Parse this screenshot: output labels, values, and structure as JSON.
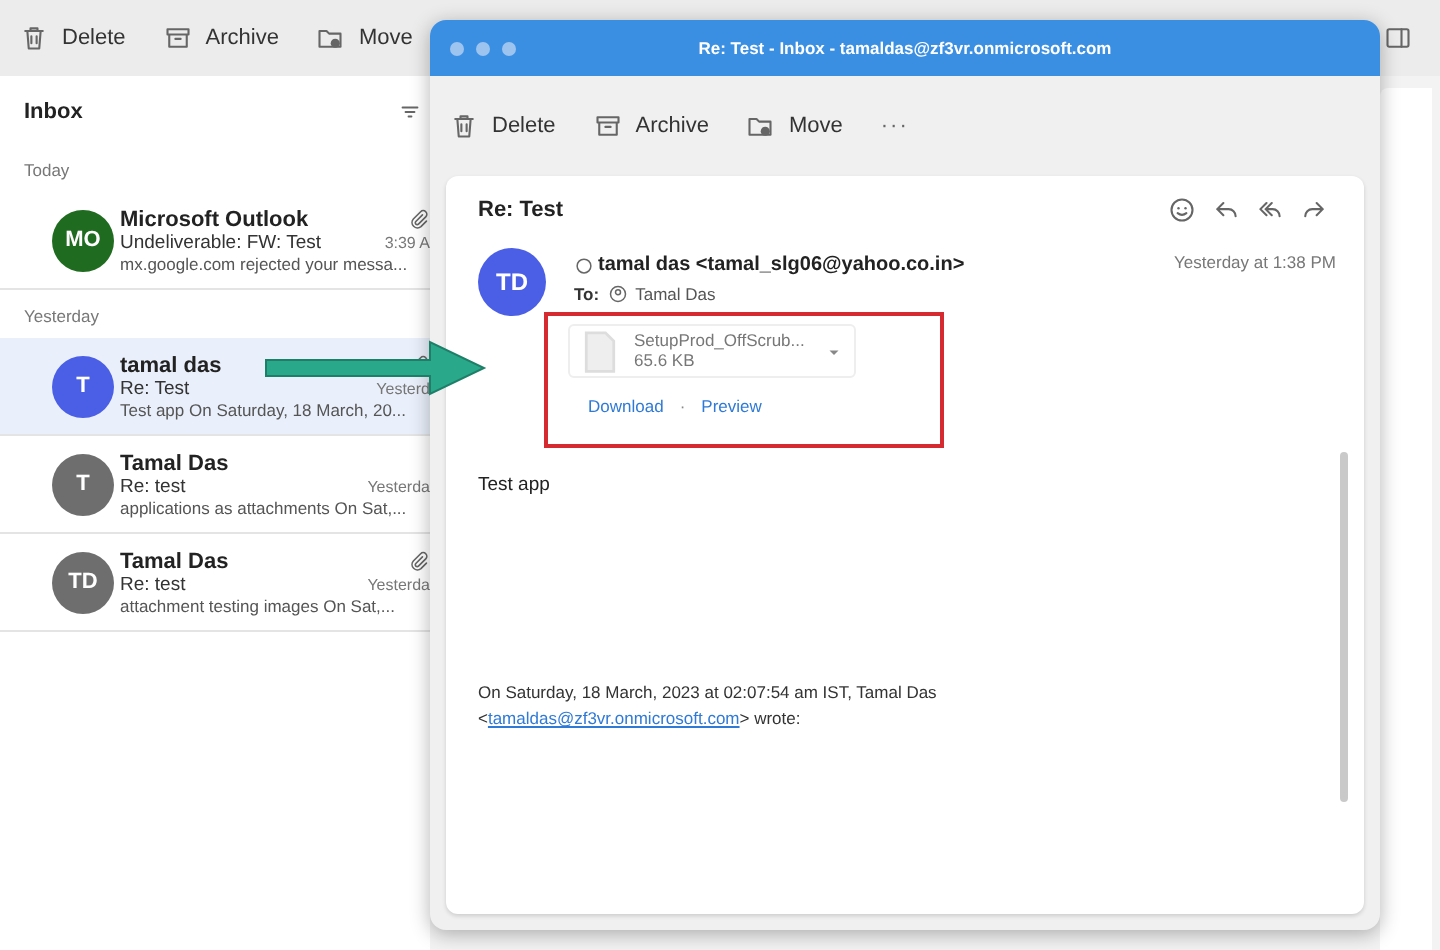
{
  "main_window": {
    "toolbar": [
      {
        "kind": "delete",
        "label": "Delete"
      },
      {
        "kind": "archive",
        "label": "Archive"
      },
      {
        "kind": "move",
        "label": "Move"
      }
    ],
    "folder": {
      "title": "Inbox"
    },
    "groups": [
      {
        "label": "Today",
        "messages": [
          {
            "initials": "MO",
            "color": "#1f6b1f",
            "sender": "Microsoft Outlook",
            "subject": "Undeliverable: FW: Test",
            "time": "3:39 A",
            "preview": "mx.google.com rejected your messa...",
            "attachment": true,
            "selected": false
          }
        ]
      },
      {
        "label": "Yesterday",
        "messages": [
          {
            "initials": "T",
            "color": "#4a5ee6",
            "sender": "tamal das",
            "subject": "Re: Test",
            "time": "Yesterd",
            "preview": "Test app On Saturday, 18 March, 20...",
            "attachment": true,
            "selected": true
          },
          {
            "initials": "T",
            "color": "#6e6e6e",
            "sender": "Tamal Das",
            "subject": "Re: test",
            "time": "Yesterda",
            "preview": "applications as attachments On Sat,...",
            "attachment": false,
            "selected": false
          },
          {
            "initials": "TD",
            "color": "#6e6e6e",
            "sender": "Tamal Das",
            "subject": "Re: test",
            "time": "Yesterda",
            "preview": "attachment testing images On Sat,...",
            "attachment": true,
            "selected": false
          }
        ]
      }
    ]
  },
  "reader_window": {
    "title": "Re: Test - Inbox - tamaldas@zf3vr.onmicrosoft.com",
    "toolbar": [
      {
        "kind": "delete",
        "label": "Delete"
      },
      {
        "kind": "archive",
        "label": "Archive"
      },
      {
        "kind": "move",
        "label": "Move"
      },
      {
        "kind": "more",
        "label": "···"
      }
    ],
    "message": {
      "subject": "Re: Test",
      "avatar_initials": "TD",
      "from": "tamal das <tamal_slg06@yahoo.co.in>",
      "date": "Yesterday at 1:38 PM",
      "to_label": "To:",
      "to": "Tamal Das",
      "attachment": {
        "name": "SetupProd_OffScrub...",
        "size": "65.6 KB",
        "actions": [
          "Download",
          "Preview"
        ],
        "separator": "·",
        "highlighted": true
      },
      "body": "Test app",
      "quote_line": "On Saturday, 18 March, 2023 at 02:07:54 am IST, Tamal Das",
      "quote_prefix": "<",
      "quote_link": "tamaldas@zf3vr.onmicrosoft.com",
      "quote_suffix": "> wrote:"
    }
  },
  "annotation_arrow": true
}
